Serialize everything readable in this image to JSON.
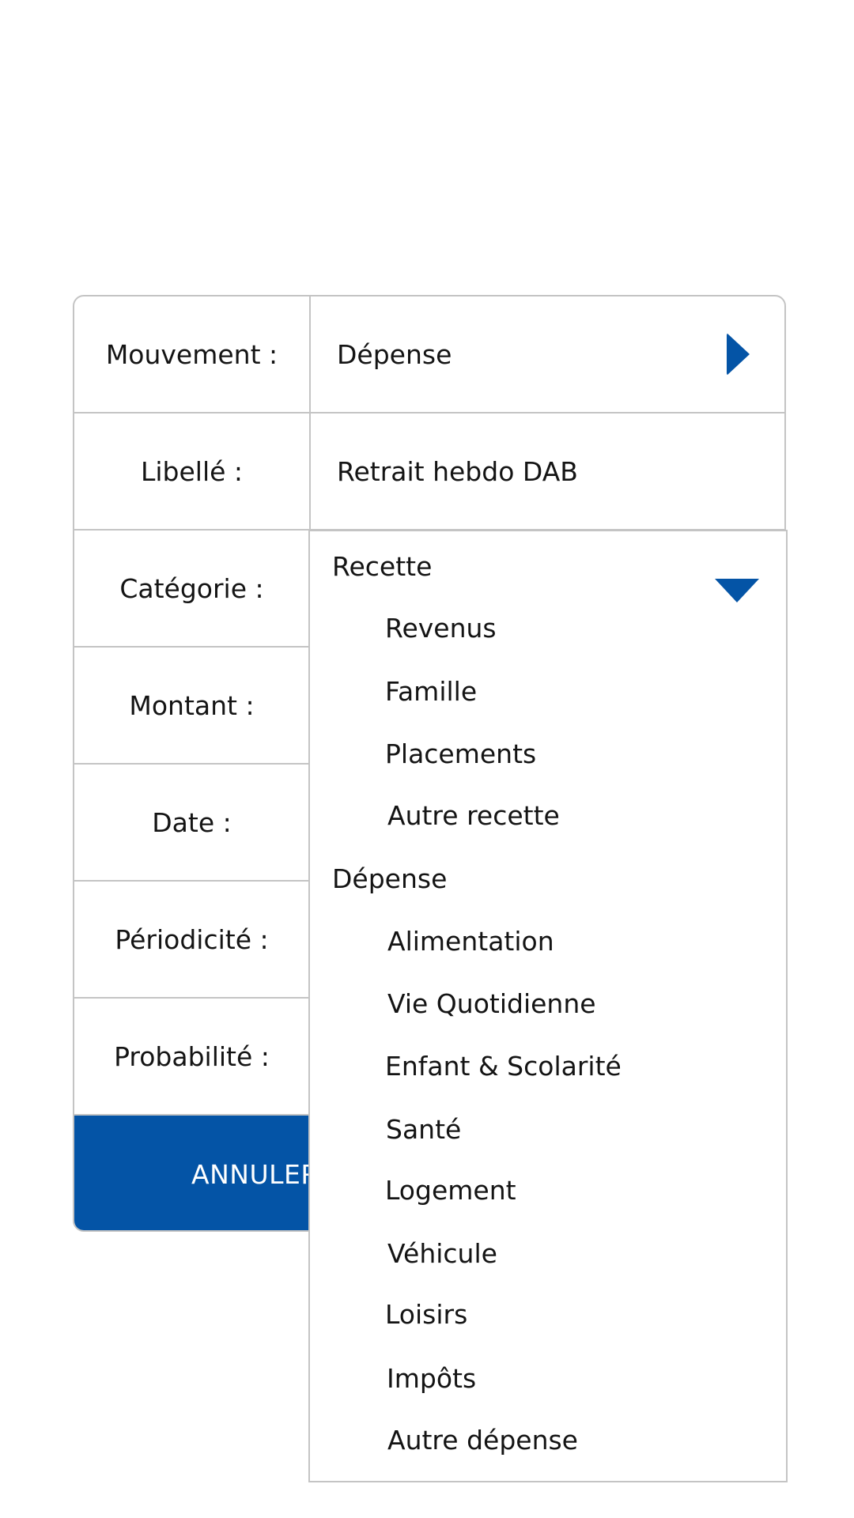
{
  "form": {
    "rows": [
      {
        "label": "Mouvement :",
        "value": "Dépense"
      },
      {
        "label": "Libellé :",
        "value": "Retrait hebdo DAB"
      },
      {
        "label": "Catégorie :",
        "value": ""
      },
      {
        "label": "Montant :",
        "value": ""
      },
      {
        "label": "Date :",
        "value": ""
      },
      {
        "label": "Périodicité :",
        "value": ""
      },
      {
        "label": "Probabilité :",
        "value": ""
      }
    ],
    "cancel_label": "ANNULER"
  },
  "dropdown": {
    "groups": [
      {
        "label": "Recette",
        "items": [
          "Revenus",
          "Famille",
          "Placements",
          "Autre recette"
        ]
      },
      {
        "label": "Dépense",
        "items": [
          "Alimentation",
          "Vie Quotidienne",
          "Enfant & Scolarité",
          "Santé",
          "Logement",
          "Véhicule",
          "Loisirs",
          "Impôts",
          "Autre dépense"
        ]
      }
    ]
  },
  "colors": {
    "accent": "#0454a6",
    "border": "#c4c4c4",
    "text": "#141414"
  },
  "icons": {
    "mouvement_chevron": "chevron-right-icon",
    "dropdown_caret": "caret-down-icon"
  }
}
